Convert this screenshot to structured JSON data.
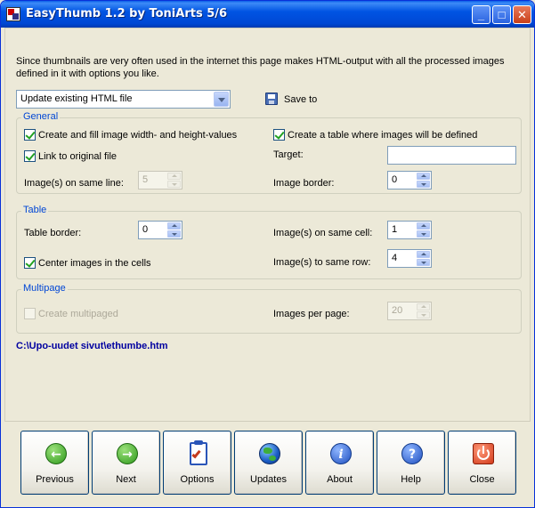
{
  "window": {
    "title": "EasyThumb 1.2 by ToniArts 5/6"
  },
  "intro_text": "Since thumbnails are very often used in the internet this page makes HTML-output with all the processed images defined in it with options you like.",
  "output_mode": {
    "selected": "Update existing HTML file"
  },
  "save_to": {
    "label": "Save to"
  },
  "general": {
    "title": "General",
    "fill_sizes": {
      "label": "Create and fill image width- and height-values",
      "checked": true
    },
    "create_table": {
      "label": "Create a table where images will be defined",
      "checked": true
    },
    "link_original": {
      "label": "Link to original file",
      "checked": true
    },
    "target_label": "Target:",
    "target_value": "",
    "images_same_line_label": "Image(s) on same line:",
    "images_same_line_value": "5",
    "image_border_label": "Image border:",
    "image_border_value": "0"
  },
  "table": {
    "title": "Table",
    "table_border_label": "Table border:",
    "table_border_value": "0",
    "images_same_cell_label": "Image(s) on same cell:",
    "images_same_cell_value": "1",
    "center_images": {
      "label": "Center images in the cells",
      "checked": true
    },
    "images_same_row_label": "Image(s) to same row:",
    "images_same_row_value": "4"
  },
  "multipage": {
    "title": "Multipage",
    "create_multipaged": {
      "label": "Create multipaged",
      "checked": false
    },
    "images_per_page_label": "Images per page:",
    "images_per_page_value": "20"
  },
  "output_path": "C:\\Upo-uudet sivut\\ethumbe.htm",
  "buttons": {
    "previous": "Previous",
    "next": "Next",
    "options": "Options",
    "updates": "Updates",
    "about": "About",
    "help": "Help",
    "close": "Close"
  },
  "colors": {
    "accent": "#0046d5",
    "path": "#0000a0"
  }
}
